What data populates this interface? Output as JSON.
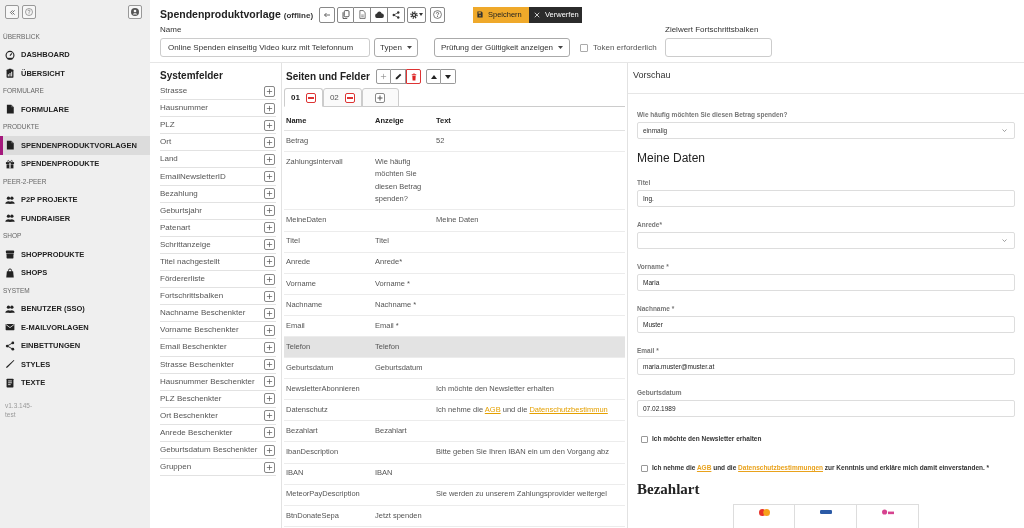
{
  "sidebar": {
    "sections": [
      {
        "title": "ÜBERBLICK",
        "items": [
          {
            "label": "DASHBOARD",
            "selected": false
          },
          {
            "label": "ÜBERSICHT",
            "selected": false
          }
        ]
      },
      {
        "title": "FORMULARE",
        "items": [
          {
            "label": "FORMULARE",
            "selected": false
          }
        ]
      },
      {
        "title": "PRODUKTE",
        "items": [
          {
            "label": "SPENDENPRODUKTVORLAGEN",
            "selected": true
          },
          {
            "label": "SPENDENPRODUKTE",
            "selected": false
          }
        ]
      },
      {
        "title": "PEER-2-PEER",
        "items": [
          {
            "label": "P2P PROJEKTE",
            "selected": false
          },
          {
            "label": "FUNDRAISER",
            "selected": false
          }
        ]
      },
      {
        "title": "SHOP",
        "items": [
          {
            "label": "SHOPPRODUKTE",
            "selected": false
          },
          {
            "label": "SHOPS",
            "selected": false
          }
        ]
      },
      {
        "title": "SYSTEM",
        "items": [
          {
            "label": "BENUTZER (SSO)",
            "selected": false
          },
          {
            "label": "E-MAILVORLAGEN",
            "selected": false
          },
          {
            "label": "EINBETTUNGEN",
            "selected": false
          },
          {
            "label": "STYLES",
            "selected": false
          },
          {
            "label": "TEXTE",
            "selected": false
          }
        ]
      }
    ],
    "version": "v1.3.145-test"
  },
  "header": {
    "title": "Spendenproduktvorlage",
    "status": "(offline)",
    "save_button": "Speichern",
    "discard_button": "Verwerfen"
  },
  "settings": {
    "name": {
      "label": "Name",
      "value": "Online Spenden einseitig Video kurz mit Telefonnum"
    },
    "types_dropdown": "Typen",
    "validation_dropdown": "Prüfung der Gültigkeit anzeigen",
    "token": {
      "label": "Token erforderlich",
      "checked": false
    },
    "progress_target": {
      "label": "Zielwert Fortschrittsbalken"
    }
  },
  "system_fields": {
    "title": "Systemfelder",
    "items": [
      "Strasse",
      "Hausnummer",
      "PLZ",
      "Ort",
      "Land",
      "EmailNewsletterID",
      "Bezahlung",
      "Geburtsjahr",
      "Patenart",
      "Schrittanzeige",
      "Titel nachgestellt",
      "Fördererliste",
      "Fortschrittsbalken",
      "Nachname Beschenkter",
      "Vorname Beschenkter",
      "Email Beschenkter",
      "Strasse Beschenkter",
      "Hausnummer Beschenkter",
      "PLZ Beschenkter",
      "Ort Beschenkter",
      "Anrede Beschenkter",
      "Geburtsdatum Beschenkter",
      "Gruppen"
    ]
  },
  "pages": {
    "title": "Seiten und Felder",
    "tabs": [
      {
        "label": "01",
        "selected": true
      },
      {
        "label": "02",
        "selected": false
      }
    ],
    "columns": [
      "Name",
      "Anzeige",
      "Text"
    ],
    "rows": [
      {
        "name": "Betrag",
        "text": "52",
        "selected": false
      },
      {
        "name": "Zahlungsintervall",
        "display": "Wie häufig möchten Sie diesen Betrag spenden?",
        "selected": false
      },
      {
        "name": "MeineDaten",
        "text": "Meine Daten",
        "selected": false
      },
      {
        "name": "Titel",
        "display": "Titel",
        "selected": false
      },
      {
        "name": "Anrede",
        "display": "Anrede*",
        "selected": false
      },
      {
        "name": "Vorname",
        "display": "Vorname *",
        "selected": false
      },
      {
        "name": "Nachname",
        "display": "Nachname *",
        "selected": false
      },
      {
        "name": "Email",
        "display": "Email *",
        "selected": false
      },
      {
        "name": "Telefon",
        "display": "Telefon",
        "selected": true
      },
      {
        "name": "Geburtsdatum",
        "display": "Geburtsdatum",
        "selected": false
      },
      {
        "name": "NewsletterAbonnieren",
        "text": "Ich möchte den Newsletter erhalten",
        "selected": false
      },
      {
        "name": "Datenschutz",
        "text_parts": [
          {
            "kind": "plain",
            "text": "Ich nehme die "
          },
          {
            "kind": "link",
            "text": "AGB"
          },
          {
            "kind": "plain",
            "text": " und die "
          },
          {
            "kind": "link",
            "text": "Datenschutzbestimmun"
          }
        ],
        "selected": false
      },
      {
        "name": "Bezahlart",
        "display": "Bezahlart",
        "selected": false
      },
      {
        "name": "IbanDescription",
        "text": "Bitte geben Sie Ihren IBAN ein um den Vorgang abz",
        "selected": false
      },
      {
        "name": "IBAN",
        "display": "IBAN",
        "selected": false
      },
      {
        "name": "MeteorPayDescription",
        "text": "Sie werden zu unserem Zahlungsprovider weitergel",
        "selected": false
      },
      {
        "name": "BtnDonateSepa",
        "display": "Jetzt spenden",
        "selected": false
      }
    ]
  },
  "preview": {
    "title": "Vorschau",
    "items": [
      {
        "kind": "select",
        "label": "Wie häufig möchten Sie diesen Betrag spenden?",
        "value": "einmalig"
      },
      {
        "kind": "heading",
        "text": "Meine Daten"
      },
      {
        "kind": "input",
        "label": "Titel",
        "value": "Ing."
      },
      {
        "kind": "select",
        "label": "Anrede*"
      },
      {
        "kind": "input",
        "label": "Vorname *",
        "value": "Maria"
      },
      {
        "kind": "input",
        "label": "Nachname *",
        "value": "Muster"
      },
      {
        "kind": "input",
        "label": "Email *",
        "value": "maria.muster@muster.at"
      },
      {
        "kind": "input",
        "label": "Geburtsdatum",
        "value": "07.02.1989"
      },
      {
        "kind": "checkbox",
        "checked": false,
        "parts": [
          {
            "kind": "plain",
            "text": "Ich möchte den Newsletter erhalten"
          }
        ]
      },
      {
        "kind": "checkbox",
        "checked": false,
        "parts": [
          {
            "kind": "plain",
            "text": "Ich nehme die "
          },
          {
            "kind": "link",
            "text": "AGB"
          },
          {
            "kind": "plain",
            "text": " und die "
          },
          {
            "kind": "link",
            "text": "Datenschutzbestimmungen"
          },
          {
            "kind": "plain",
            "text": " zur Kenntnis und erkläre mich damit einverstanden. *"
          }
        ]
      },
      {
        "kind": "title",
        "text": "Bezahlart"
      },
      {
        "kind": "payment_tiles"
      }
    ]
  }
}
